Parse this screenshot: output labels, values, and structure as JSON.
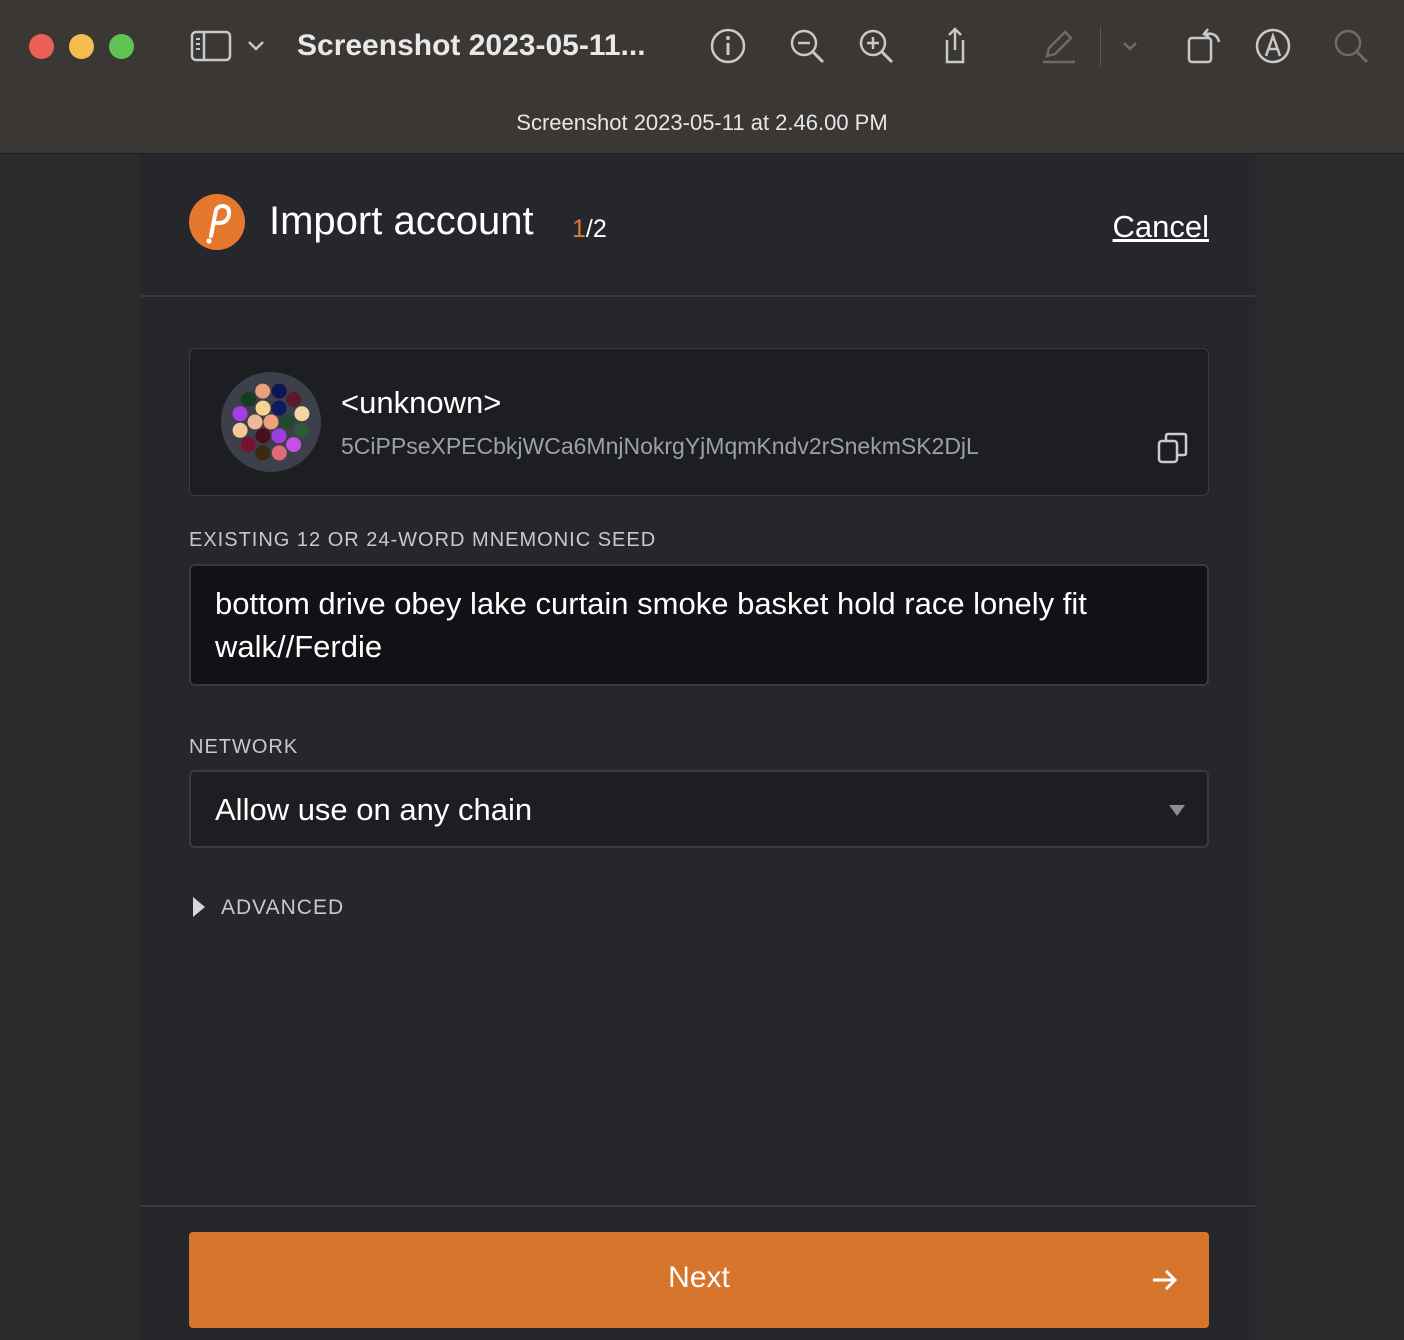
{
  "window": {
    "title": "Screenshot 2023-05-11...",
    "subtitle": "Screenshot 2023-05-11 at 2.46.00 PM",
    "toolbar_icons": [
      "sidebar-icon",
      "chevron-down-icon",
      "info-icon",
      "zoom-out-icon",
      "zoom-in-icon",
      "share-icon",
      "pencil-icon",
      "chevron-down-icon",
      "rotate-icon",
      "markup-icon",
      "search-icon"
    ]
  },
  "header": {
    "title": "Import account",
    "step_current": "1",
    "step_total": "/2",
    "cancel_label": "Cancel",
    "accent_color": "#e6782e"
  },
  "account": {
    "name": "<unknown>",
    "address": "5CiPPseXPECbkjWCa6MnjNokrgYjMqmKndv2rSnekmSK2DjL"
  },
  "seed": {
    "label": "EXISTING 12 OR 24-WORD MNEMONIC SEED",
    "value": "bottom drive obey lake curtain smoke basket hold race lonely fit walk//Ferdie"
  },
  "network": {
    "label": "NETWORK",
    "selected": "Allow use on any chain"
  },
  "advanced": {
    "label": "ADVANCED"
  },
  "footer": {
    "next_label": "Next"
  }
}
